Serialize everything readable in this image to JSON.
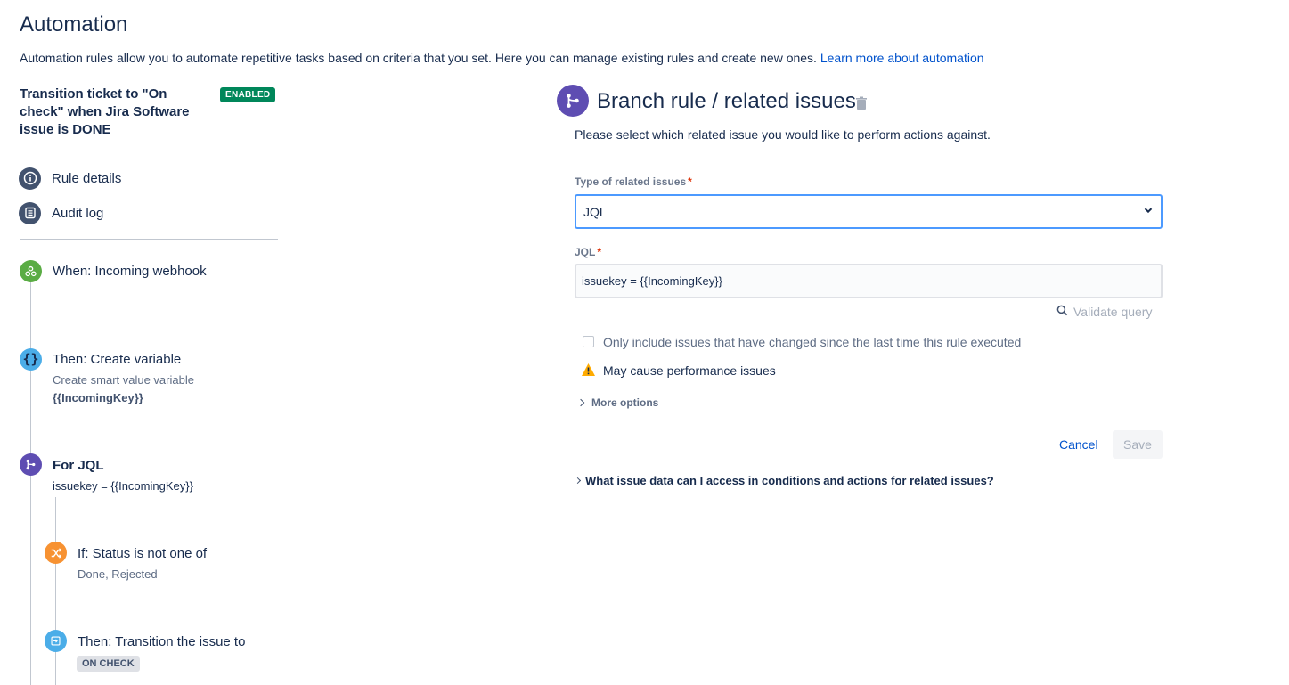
{
  "page": {
    "title": "Automation",
    "description": "Automation rules allow you to automate repetitive tasks based on criteria that you set. Here you can manage existing rules and create new ones.",
    "learn_more": "Learn more about automation"
  },
  "rule": {
    "name": "Transition ticket to \"On check\" when Jira Software issue is DONE",
    "status": "ENABLED"
  },
  "nav": {
    "rule_details": "Rule details",
    "audit_log": "Audit log"
  },
  "steps": {
    "trigger": {
      "title": "When: Incoming webhook"
    },
    "variable": {
      "title": "Then: Create variable",
      "sub": "Create smart value variable",
      "value": "{{IncomingKey}}"
    },
    "branch": {
      "title": "For JQL",
      "sub": "issuekey = {{IncomingKey}}"
    },
    "condition": {
      "title": "If: Status is not one of",
      "sub": "Done, Rejected"
    },
    "action": {
      "title": "Then: Transition the issue to",
      "lozenge": "ON CHECK"
    }
  },
  "panel": {
    "title": "Branch rule / related issues",
    "description": "Please select which related issue you would like to perform actions against.",
    "type_label": "Type of related issues",
    "type_value": "JQL",
    "jql_label": "JQL",
    "jql_value": "issuekey = {{IncomingKey}}",
    "validate": "Validate query",
    "checkbox_label": "Only include issues that have changed since the last time this rule executed",
    "warning": "May cause performance issues",
    "more_options": "More options",
    "cancel": "Cancel",
    "save": "Save",
    "faq": "What issue data can I access in conditions and actions for related issues?",
    "required_mark": "*"
  },
  "colors": {
    "enabled": "#00875a",
    "link": "#0052cc",
    "trigger": "#5aac44",
    "variable": "#4bade8",
    "branch": "#5e4db2",
    "condition": "#f79232",
    "action": "#4bade8",
    "focus": "#4c9aff"
  },
  "icons": {
    "rule_details": "info-icon",
    "audit_log": "list-icon",
    "trigger": "webhook-icon",
    "variable": "braces-icon",
    "branch": "branch-icon",
    "condition": "shuffle-icon",
    "action": "transition-icon",
    "delete": "trash-icon",
    "search": "search-icon",
    "warning": "warning-icon"
  }
}
